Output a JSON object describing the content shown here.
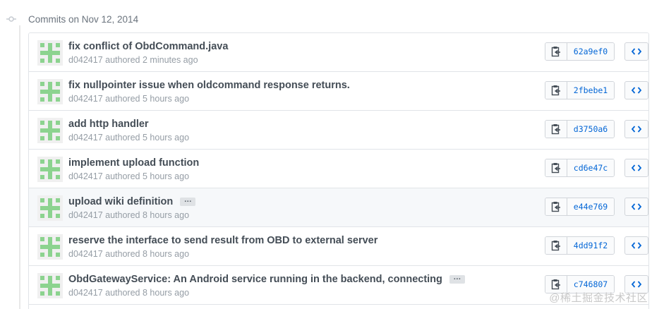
{
  "group": {
    "title": "Commits on Nov 12, 2014",
    "icon": "git-commit-icon"
  },
  "colors": {
    "link": "#0366d6",
    "avatar": "#8cd38f",
    "border": "#e1e4e8",
    "highlight": "#f6f8fa"
  },
  "commits": [
    {
      "title": "fix conflict of ObdCommand.java",
      "author": "d042417",
      "verb": "authored",
      "time": "2 minutes ago",
      "sha": "62a9ef0",
      "has_more": false,
      "highlighted": false
    },
    {
      "title": "fix nullpointer issue when oldcommand response returns.",
      "author": "d042417",
      "verb": "authored",
      "time": "5 hours ago",
      "sha": "2fbebe1",
      "has_more": false,
      "highlighted": false
    },
    {
      "title": "add http handler",
      "author": "d042417",
      "verb": "authored",
      "time": "5 hours ago",
      "sha": "d3750a6",
      "has_more": false,
      "highlighted": false
    },
    {
      "title": "implement upload function",
      "author": "d042417",
      "verb": "authored",
      "time": "5 hours ago",
      "sha": "cd6e47c",
      "has_more": false,
      "highlighted": false
    },
    {
      "title": "upload wiki definition",
      "author": "d042417",
      "verb": "authored",
      "time": "8 hours ago",
      "sha": "e44e769",
      "has_more": true,
      "highlighted": true
    },
    {
      "title": "reserve the interface to send result from OBD to external server",
      "author": "d042417",
      "verb": "authored",
      "time": "8 hours ago",
      "sha": "4dd91f2",
      "has_more": false,
      "highlighted": false
    },
    {
      "title": "ObdGatewayService: An Android service running in the backend, connecting",
      "author": "d042417",
      "verb": "authored",
      "time": "8 hours ago",
      "sha": "c746807",
      "has_more": true,
      "highlighted": false
    }
  ],
  "labels": {
    "more": "…"
  },
  "icons": {
    "copy": "clippy-icon",
    "browse": "code-icon"
  },
  "watermark": "@稀土掘金技术社区"
}
